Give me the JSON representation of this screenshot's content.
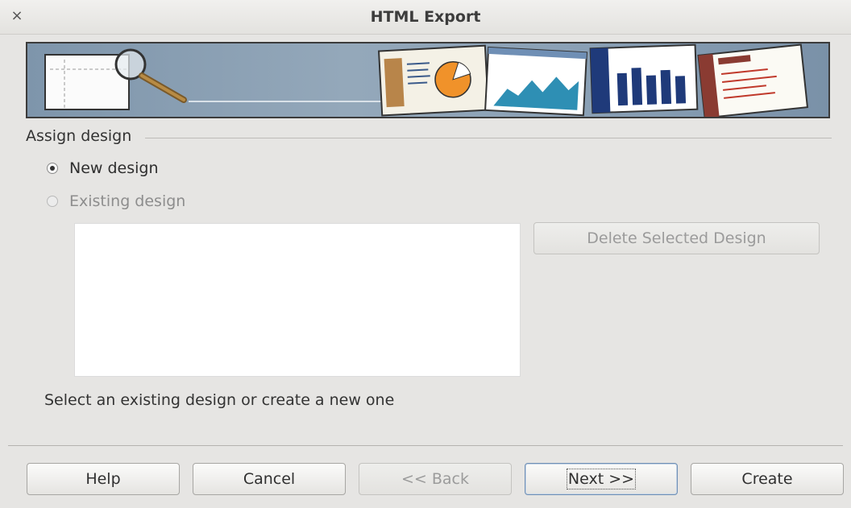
{
  "window": {
    "title": "HTML Export",
    "close_icon": "×"
  },
  "banner": {
    "icon": "html-export-banner-illustration"
  },
  "assign": {
    "legend": "Assign design",
    "new_design": {
      "label": "New design",
      "checked": true
    },
    "existing_design": {
      "label": "Existing design",
      "checked": false,
      "enabled": false
    },
    "design_list": [],
    "delete_button": "Delete Selected Design",
    "hint": "Select an existing design or create a new one"
  },
  "footer": {
    "help": "Help",
    "cancel": "Cancel",
    "back": "<< Back",
    "next": "Next >>",
    "create": "Create"
  }
}
